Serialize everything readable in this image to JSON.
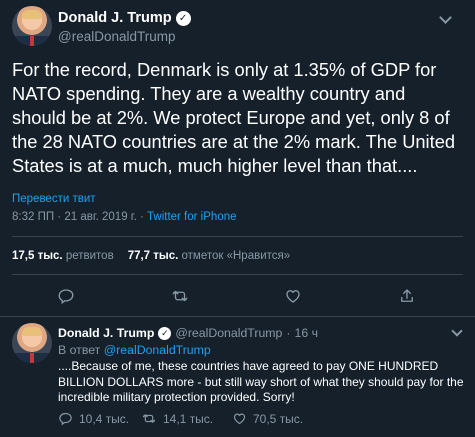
{
  "tweet": {
    "author_name": "Donald J. Trump",
    "handle": "@realDonaldTrump",
    "text": "For the record, Denmark is only at 1.35% of GDP for NATO spending. They are a wealthy country and should be at 2%. We protect Europe and yet, only 8 of the 28 NATO countries are at the 2% mark. The United States is at a much, much higher level than that....",
    "translate_label": "Перевести твит",
    "timestamp": "8:32 ПП · 21 авг. 2019 г.",
    "separator": " · ",
    "source": "Twitter for iPhone",
    "retweets_count": "17,5 тыс.",
    "retweets_label": "ретвитов",
    "likes_count": "77,7 тыс.",
    "likes_label": "отметок «Нравится»"
  },
  "reply": {
    "author_name": "Donald J. Trump",
    "handle": "@realDonaldTrump",
    "time_sep": "·",
    "time": "16 ч",
    "in_reply_prefix": "В ответ",
    "in_reply_handle": "@realDonaldTrump",
    "text": "....Because of me, these countries have agreed to pay ONE HUNDRED BILLION DOLLARS more - but still way short of what they should pay for the incredible military protection provided. Sorry!",
    "replies_count": "10,4 тыс.",
    "retweets_count": "14,1 тыс.",
    "likes_count": "70,5 тыс."
  },
  "colors": {
    "background": "#15202b",
    "accent": "#1da1f2",
    "secondary_text": "#8899a6",
    "divider": "#38444d"
  },
  "icons": [
    "verified-badge-icon",
    "chevron-down-icon",
    "reply-icon",
    "retweet-icon",
    "like-icon",
    "share-icon"
  ]
}
